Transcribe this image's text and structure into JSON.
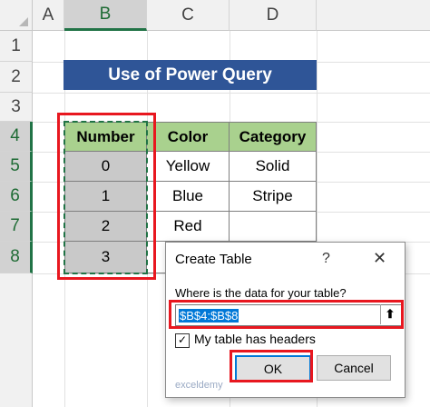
{
  "columns": [
    "A",
    "B",
    "C",
    "D"
  ],
  "rows": [
    "1",
    "2",
    "3",
    "4",
    "5",
    "6",
    "7",
    "8"
  ],
  "title": "Use of Power Query",
  "table": {
    "headers": [
      "Number",
      "Color",
      "Category"
    ],
    "rows": [
      [
        "0",
        "Yellow",
        "Solid"
      ],
      [
        "1",
        "Blue",
        "Stripe"
      ],
      [
        "2",
        "Red",
        ""
      ],
      [
        "3",
        "",
        ""
      ]
    ]
  },
  "dialog": {
    "title": "Create Table",
    "help": "?",
    "close": "✕",
    "prompt": "Where is the data for your table?",
    "range": "$B$4:$B$8",
    "collapse_icon": "⬆",
    "checkbox_label": "My table has headers",
    "checkbox_checked": "✓",
    "ok_label": "OK",
    "cancel_label": "Cancel"
  },
  "watermark": "exceldemy",
  "colors": {
    "title_bg": "#2f5597",
    "header_bg": "#a9d18e",
    "number_bg": "#c9c9c9",
    "highlight": "#e8171f",
    "selection": "#217346"
  }
}
